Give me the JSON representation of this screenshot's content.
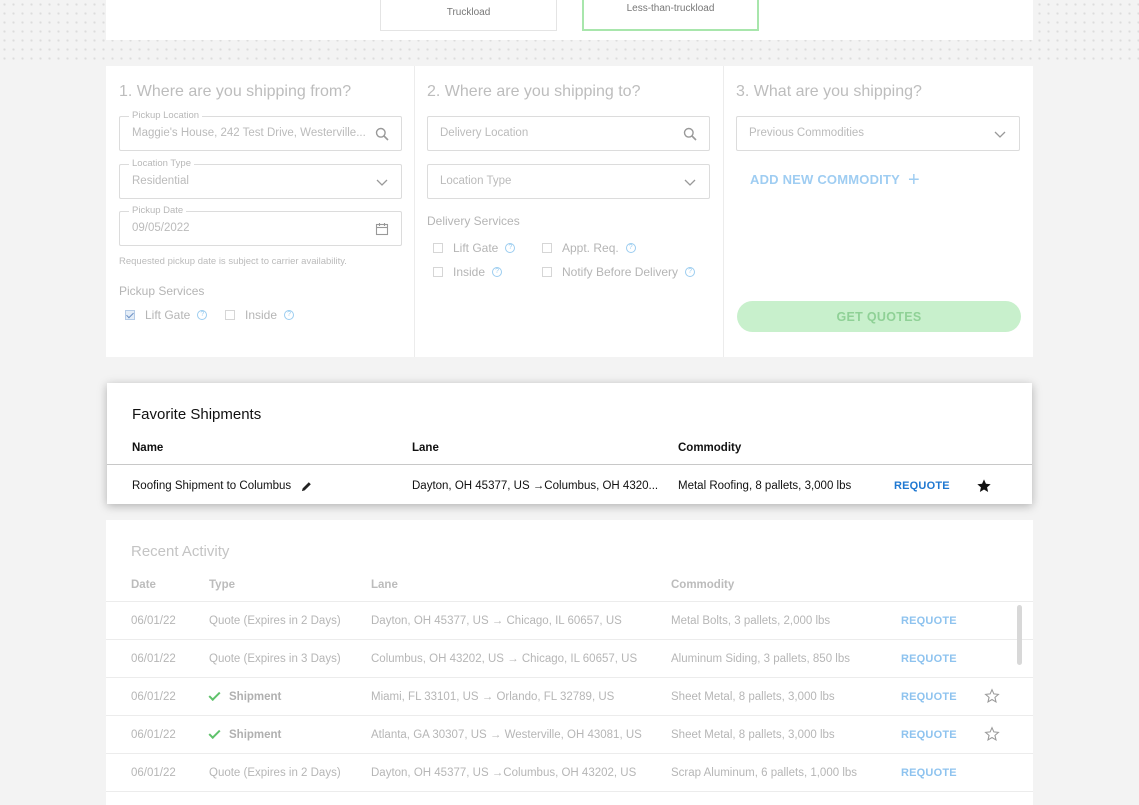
{
  "modes": {
    "truckload": "Truckload",
    "ltl": "Less-than-truckload"
  },
  "from": {
    "heading": "1. Where are you shipping from?",
    "pickup_label": "Pickup Location",
    "pickup_value": "Maggie's House, 242 Test Drive, Westerville...",
    "type_label": "Location Type",
    "type_value": "Residential",
    "date_label": "Pickup Date",
    "date_value": "09/05/2022",
    "date_note": "Requested pickup date is subject to carrier availability.",
    "services_title": "Pickup Services",
    "services": [
      {
        "label": "Lift Gate",
        "checked": true
      },
      {
        "label": "Inside",
        "checked": false
      }
    ]
  },
  "to": {
    "heading": "2. Where are you shipping to?",
    "delivery_placeholder": "Delivery Location",
    "type_placeholder": "Location Type",
    "services_title": "Delivery Services",
    "services": [
      {
        "label": "Lift Gate",
        "checked": false
      },
      {
        "label": "Appt. Req.",
        "checked": false
      },
      {
        "label": "Inside",
        "checked": false
      },
      {
        "label": "Notify Before Delivery",
        "checked": false
      }
    ]
  },
  "what": {
    "heading": "3. What are you shipping?",
    "commodities_placeholder": "Previous Commodities",
    "add_label": "ADD NEW COMMODITY",
    "quotes_label": "GET QUOTES"
  },
  "favorites": {
    "title": "Favorite Shipments",
    "headers": {
      "name": "Name",
      "lane": "Lane",
      "commodity": "Commodity"
    },
    "row": {
      "name": "Roofing Shipment to Columbus",
      "lane": "Dayton, OH 45377, US →Columbus, OH 4320...",
      "commodity": "Metal Roofing, 8 pallets, 3,000 lbs",
      "action": "REQUOTE"
    }
  },
  "recent": {
    "title": "Recent Activity",
    "headers": {
      "date": "Date",
      "type": "Type",
      "lane": "Lane",
      "commodity": "Commodity"
    },
    "rows": [
      {
        "date": "06/01/22",
        "type": "Quote (Expires in 2 Days)",
        "lane": "Dayton, OH 45377, US → Chicago, IL 60657, US",
        "commodity": "Metal Bolts, 3 pallets, 2,000 lbs",
        "action": "REQUOTE"
      },
      {
        "date": "06/01/22",
        "type": "Quote (Expires in 3 Days)",
        "lane": "Columbus, OH 43202, US → Chicago, IL 60657, US",
        "commodity": "Aluminum Siding, 3 pallets, 850 lbs",
        "action": "REQUOTE"
      },
      {
        "date": "06/01/22",
        "type": "Shipment",
        "lane": "Miami, FL 33101, US → Orlando, FL 32789, US",
        "commodity": "Sheet Metal, 8 pallets, 3,000 lbs",
        "action": "REQUOTE"
      },
      {
        "date": "06/01/22",
        "type": "Shipment",
        "lane": "Atlanta, GA 30307, US → Westerville, OH 43081, US",
        "commodity": "Sheet Metal, 8 pallets, 3,000 lbs",
        "action": "REQUOTE"
      },
      {
        "date": "06/01/22",
        "type": "Quote (Expires in 2 Days)",
        "lane": "Dayton, OH 45377, US →Columbus, OH 43202, US",
        "commodity": "Scrap Aluminum, 6 pallets, 1,000 lbs",
        "action": "REQUOTE"
      }
    ]
  },
  "colors": {
    "requote_active": "#1f78d1",
    "requote_muted": "#8ec3ef",
    "accent_green": "#a8e6ac"
  }
}
